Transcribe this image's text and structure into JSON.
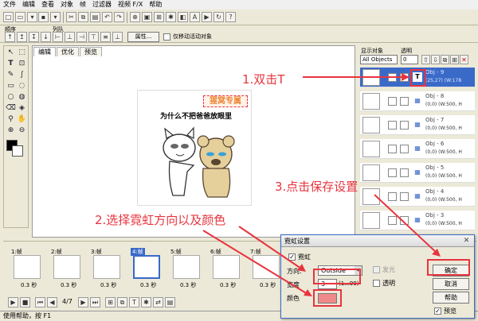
{
  "menu": [
    "文件",
    "编辑",
    "查看",
    "对象",
    "帧",
    "过滤器",
    "视频 F/X",
    "帮助"
  ],
  "toolbar2": {
    "order_label": "顺序",
    "align_label": "列队",
    "properties_button": "属性...",
    "move_active_only": "仅移动活动对象"
  },
  "tabs": [
    "编辑",
    "优化",
    "预览"
  ],
  "canvas": {
    "badge": "猩窝专属",
    "caption": "为什么不把爸爸放眼里"
  },
  "right_panel": {
    "show_objects_label": "显示对象",
    "opacity_label": "透明",
    "filter_value": "All Objects",
    "opacity_value": "0",
    "objects": [
      {
        "name": "Obj - 9",
        "info": "(25,27) (W:178",
        "type": "T"
      },
      {
        "name": "Obj - 8",
        "info": "(0,0) (W:500, H",
        "type": "img"
      },
      {
        "name": "Obj - 7",
        "info": "(0,0) (W:500, H",
        "type": "img"
      },
      {
        "name": "Obj - 6",
        "info": "(0,0) (W:500, H",
        "type": "img"
      },
      {
        "name": "Obj - 5",
        "info": "(0,0) (W:500, H",
        "type": "img"
      },
      {
        "name": "Obj - 4",
        "info": "(0,0) (W:500, H",
        "type": "img"
      },
      {
        "name": "Obj - 3",
        "info": "(0,0) (W:500, H",
        "type": "img"
      }
    ]
  },
  "frames": [
    {
      "label": "1:帧",
      "time": "0.3 秒"
    },
    {
      "label": "2:帧",
      "time": "0.3 秒"
    },
    {
      "label": "3:帧",
      "time": "0.3 秒"
    },
    {
      "label": "4:帧",
      "time": "0.3 秒"
    },
    {
      "label": "5:帧",
      "time": "0.3 秒"
    },
    {
      "label": "6:帧",
      "time": "0.3 秒"
    },
    {
      "label": "7:帧",
      "time": "0.3 秒"
    }
  ],
  "playback": {
    "counter": "4/7"
  },
  "status": "使用帮助，按 F1",
  "dialog": {
    "title": "霓虹设置",
    "enable_label": "霓虹",
    "direction_label": "方向:",
    "direction_value": "Outside",
    "width_label": "宽度",
    "width_value": "3",
    "width_range": "(1...99)",
    "color_label": "颜色",
    "blink_label": "发光",
    "transparent_label": "透明",
    "ok": "确定",
    "cancel": "取消",
    "help": "帮助",
    "preview": "预览"
  },
  "annotations": {
    "step1": "1.双击T",
    "step2": "2.选择霓虹方向以及颜色",
    "step3": "3.点击保存设置"
  },
  "colors": {
    "annotation_red": "#e8343e",
    "selection_blue": "#3a6ac8",
    "neon_color": "#f08a8a",
    "badge_orange": "#ef8a3c"
  }
}
